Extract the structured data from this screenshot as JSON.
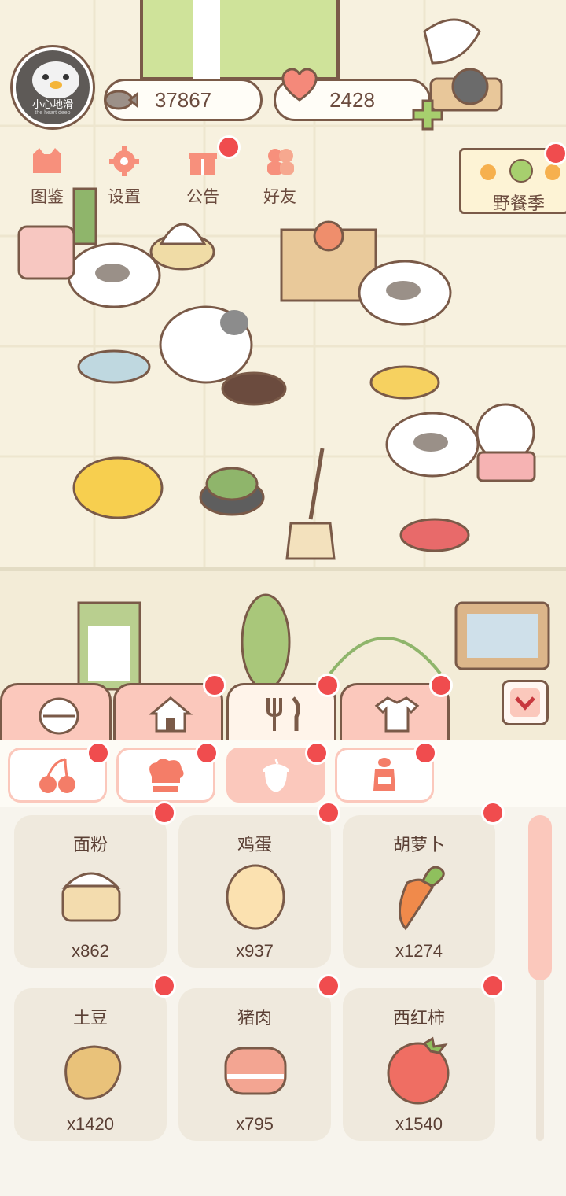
{
  "player": {
    "avatar_text": "小心地滑",
    "avatar_sub": "the heart deep"
  },
  "currency": {
    "fish": "37867",
    "hearts": "2428"
  },
  "menu": [
    {
      "label": "图鉴",
      "icon": "cat-book-icon"
    },
    {
      "label": "设置",
      "icon": "gear-icon"
    },
    {
      "label": "公告",
      "icon": "gift-icon"
    },
    {
      "label": "好友",
      "icon": "friends-icon"
    }
  ],
  "event": {
    "label": "野餐季"
  },
  "category_tabs": [
    {
      "icon": "face-icon"
    },
    {
      "icon": "house-icon"
    },
    {
      "icon": "fork-knife-icon",
      "active": true
    },
    {
      "icon": "shirt-icon"
    }
  ],
  "sub_tabs": [
    {
      "icon": "cherry-icon"
    },
    {
      "icon": "chef-hat-icon"
    },
    {
      "icon": "acorn-icon",
      "active": true
    },
    {
      "icon": "salt-shaker-icon"
    }
  ],
  "items": [
    {
      "name": "面粉",
      "qty": "x862",
      "icon": "flour-icon",
      "color": "#f3dcae"
    },
    {
      "name": "鸡蛋",
      "qty": "x937",
      "icon": "egg-icon",
      "color": "#fbe1b0"
    },
    {
      "name": "胡萝卜",
      "qty": "x1274",
      "icon": "carrot-icon",
      "color": "#f08a4b"
    },
    {
      "name": "土豆",
      "qty": "x1420",
      "icon": "potato-icon",
      "color": "#e9c27a"
    },
    {
      "name": "猪肉",
      "qty": "x795",
      "icon": "pork-icon",
      "color": "#f3a592"
    },
    {
      "name": "西红柿",
      "qty": "x1540",
      "icon": "tomato-icon",
      "color": "#ef6e63"
    }
  ],
  "colors": {
    "accent_pink": "#fbc8bc",
    "notif_red": "#f04c4e",
    "outline_brown": "#7a5a48"
  }
}
